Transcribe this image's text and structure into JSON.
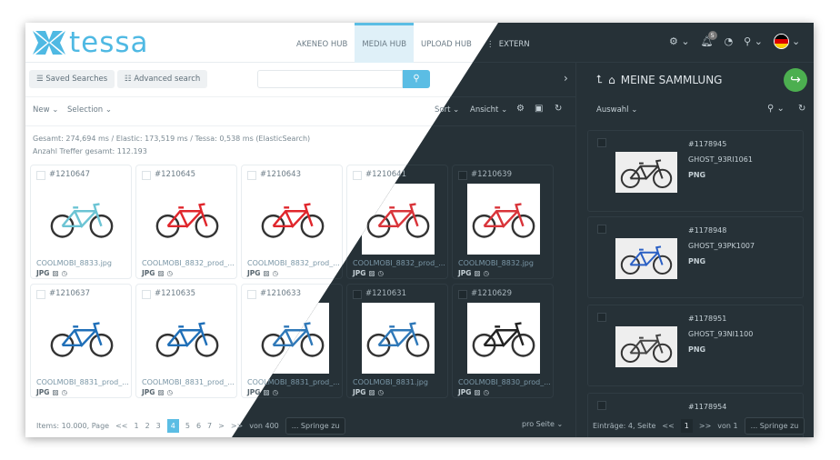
{
  "header": {
    "logo": "tessa",
    "nav": [
      {
        "label": "AKENEO HUB"
      },
      {
        "label": "MEDIA HUB",
        "active": true
      },
      {
        "label": "UPLOAD HUB"
      },
      {
        "label": "EXTERN"
      }
    ],
    "notifications_count": "5",
    "language": "de"
  },
  "toolbar": {
    "saved_searches": "Saved Searches",
    "advanced_search": "Advanced search",
    "search_value": ""
  },
  "actions": {
    "new": "New",
    "selection": "Selection",
    "sort": "Sort",
    "view": "Ansicht"
  },
  "stats": {
    "timing": "Gesamt: 274,694 ms / Elastic: 173,519 ms / Tessa: 0,538 ms (ElasticSearch)",
    "total": "Anzahl Treffer gesamt: 112.193"
  },
  "grid": [
    {
      "id": "#1210647",
      "filename": "COOLMOBI_8833.jpg",
      "type": "JPG",
      "color": "#6cc4d4"
    },
    {
      "id": "#1210645",
      "filename": "COOLMOBI_8832_prod_...",
      "type": "JPG",
      "color": "#e0262c"
    },
    {
      "id": "#1210643",
      "filename": "COOLMOBI_8832_prod_...",
      "type": "JPG",
      "color": "#e0262c"
    },
    {
      "id": "#1210641",
      "filename": "COOLMOBI_8832_prod_...",
      "type": "JPG",
      "color": "#d9343a"
    },
    {
      "id": "#1210639",
      "filename": "COOLMOBI_8832.jpg",
      "type": "JPG",
      "color": "#d9343a"
    },
    {
      "id": "#1210637",
      "filename": "COOLMOBI_8831_prod_...",
      "type": "JPG",
      "color": "#1f6fb8"
    },
    {
      "id": "#1210635",
      "filename": "COOLMOBI_8831_prod_...",
      "type": "JPG",
      "color": "#1f6fb8"
    },
    {
      "id": "#1210633",
      "filename": "COOLMOBI_8831_prod_...",
      "type": "JPG",
      "color": "#2f78b8"
    },
    {
      "id": "#1210631",
      "filename": "COOLMOBI_8831.jpg",
      "type": "JPG",
      "color": "#2f78b8"
    },
    {
      "id": "#1210629",
      "filename": "COOLMOBI_8830_prod_...",
      "type": "JPG",
      "color": "#222222"
    }
  ],
  "pagination": {
    "items_label": "Items: 10.000, Page",
    "first": "<<",
    "pages": [
      "1",
      "2",
      "3",
      "4",
      "5",
      "6",
      "7"
    ],
    "active_page": "4",
    "next": ">",
    "last": ">>",
    "of": "von 400",
    "jump_placeholder": "... Springe zu",
    "per_page": "pro Seite"
  },
  "collection": {
    "title": "MEINE SAMMLUNG",
    "selection": "Auswahl",
    "items": [
      {
        "id": "#1178945",
        "name": "GHOST_93RI1061",
        "type": "PNG",
        "color": "#333333"
      },
      {
        "id": "#1178948",
        "name": "GHOST_93PK1007",
        "type": "PNG",
        "color": "#2a5fc4"
      },
      {
        "id": "#1178951",
        "name": "GHOST_93NI1100",
        "type": "PNG",
        "color": "#444444"
      },
      {
        "id": "#1178954"
      }
    ],
    "footer": {
      "entries": "Einträge: 4, Seite",
      "first": "<<",
      "page": "1",
      "next": ">>",
      "of": "von 1",
      "jump_placeholder": "... Springe zu"
    }
  },
  "colors": {
    "accent": "#5bbde4",
    "dark_bg": "#263137",
    "share": "#4caf50"
  }
}
